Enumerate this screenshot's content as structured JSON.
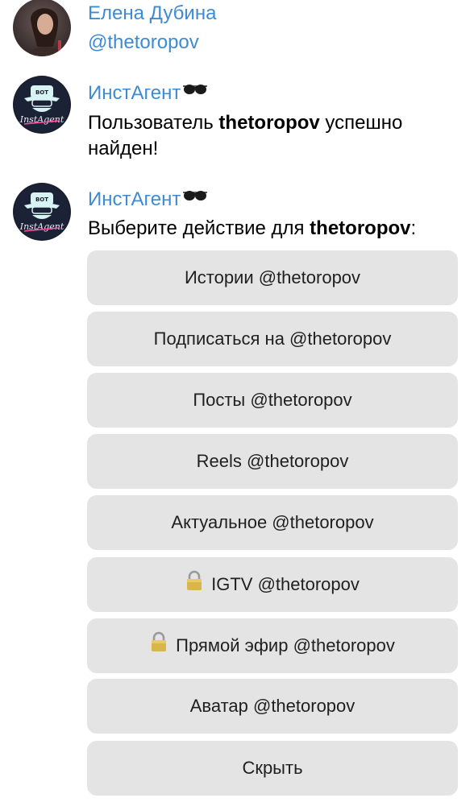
{
  "colors": {
    "sender_name": "#3d8bd3",
    "handle": "#3d8bd3",
    "button_bg": "#e4e4e4",
    "button_text": "#1f1f1f"
  },
  "messages": [
    {
      "sender": "Елена Дубина",
      "handle": "@thetoropov",
      "avatar": "user-photo-avatar"
    },
    {
      "sender": "ИнстАгент",
      "sender_emoji": "sunglasses-icon",
      "avatar": "bot-avatar",
      "avatar_text_top": "BOT",
      "avatar_text_bottom": "InstAgent",
      "text_prefix": "Пользователь ",
      "text_bold": "thetoropov",
      "text_suffix": " успешно",
      "text_line2": "найден!"
    },
    {
      "sender": "ИнстАгент",
      "sender_emoji": "sunglasses-icon",
      "avatar": "bot-avatar",
      "avatar_text_top": "BOT",
      "avatar_text_bottom": "InstAgent",
      "text_prefix": "Выберите действие для ",
      "text_bold": "thetoropov",
      "text_suffix": ":"
    }
  ],
  "buttons": [
    {
      "label": "Истории @thetoropov",
      "icon": null
    },
    {
      "label": "Подписаться на @thetoropov",
      "icon": null
    },
    {
      "label": "Посты @thetoropov",
      "icon": null
    },
    {
      "label": "Reels @thetoropov",
      "icon": null
    },
    {
      "label": "Актуальное @thetoropov",
      "icon": null
    },
    {
      "label": "IGTV @thetoropov",
      "icon": "lock-icon"
    },
    {
      "label": "Прямой эфир @thetoropov",
      "icon": "lock-icon"
    },
    {
      "label": "Аватар @thetoropov",
      "icon": null
    },
    {
      "label": "Скрыть",
      "icon": null
    }
  ]
}
